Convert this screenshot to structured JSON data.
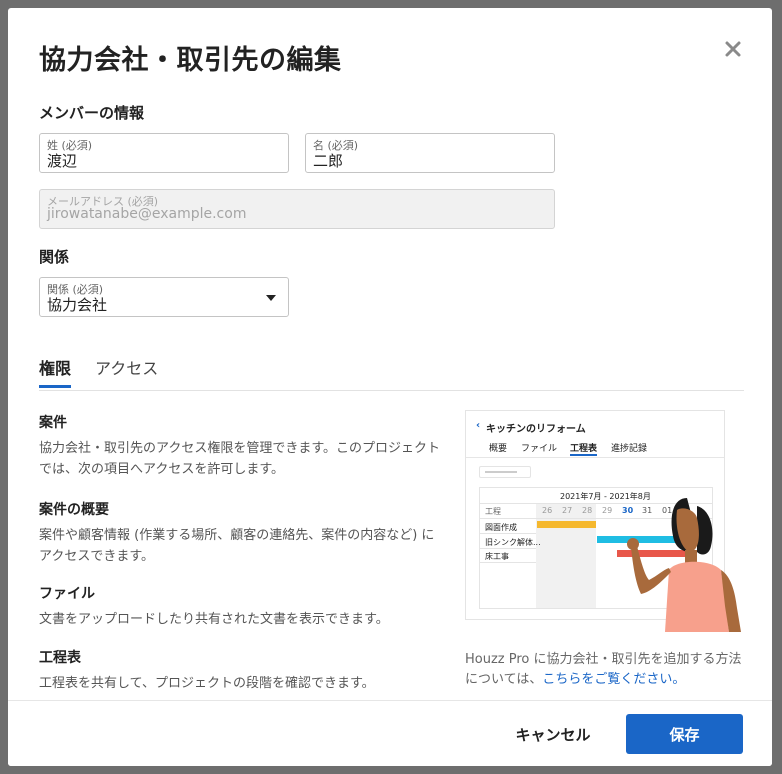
{
  "dialog": {
    "title": "協力会社・取引先の編集"
  },
  "member_section": {
    "title": "メンバーの情報",
    "last_name": {
      "label": "姓 (必須)",
      "value": "渡辺"
    },
    "first_name": {
      "label": "名 (必須)",
      "value": "二郎"
    },
    "email": {
      "label": "メールアドレス (必須)",
      "value": "jirowatanabe@example.com"
    }
  },
  "relation_section": {
    "title": "関係",
    "relation": {
      "label": "関係 (必須)",
      "value": "協力会社"
    }
  },
  "tabs": [
    {
      "label": "権限"
    },
    {
      "label": "アクセス"
    }
  ],
  "permissions": {
    "project": {
      "title": "案件",
      "desc": "協力会社・取引先のアクセス権限を管理できます。このプロジェクトでは、次の項目へアクセスを許可します。"
    },
    "overview": {
      "title": "案件の概要",
      "desc": "案件や顧客情報 (作業する場所、顧客の連絡先、案件の内容など) にアクセスできます。"
    },
    "files": {
      "title": "ファイル",
      "desc": "文書をアップロードしたり共有された文書を表示できます。"
    },
    "schedule": {
      "title": "工程表",
      "desc": "工程表を共有して、プロジェクトの段階を確認できます。"
    }
  },
  "illustration": {
    "project_title": "キッチンのリフォーム",
    "nav": [
      "概要",
      "ファイル",
      "工程表",
      "進捗記録"
    ],
    "month_range": "2021年7月 - 2021年8月",
    "header_label": "工程",
    "dates": [
      "26",
      "27",
      "28",
      "29",
      "30",
      "31",
      "01"
    ],
    "tasks": [
      "図面作成",
      "旧シンク解体...",
      "床工事"
    ]
  },
  "help": {
    "text": "Houzz Pro に協力会社・取引先を追加する方法については、",
    "link": "こちらをご覧ください。"
  },
  "footer": {
    "cancel": "キャンセル",
    "save": "保存"
  },
  "colors": {
    "primary": "#1a66c7",
    "bar_yellow": "#f5b82e",
    "bar_cyan": "#1fbde3",
    "bar_red": "#e8574a"
  }
}
